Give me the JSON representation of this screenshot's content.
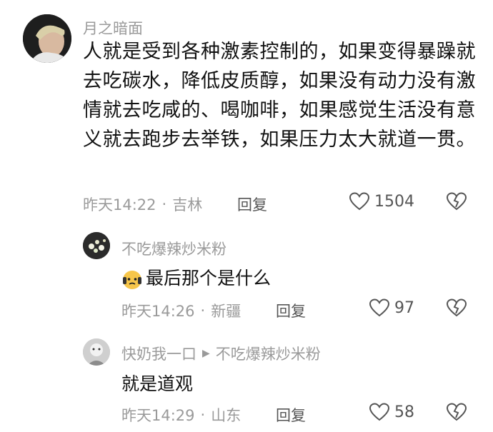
{
  "comment": {
    "username": "月之暗面",
    "text": "人就是受到各种激素控制的，如果变得暴躁就去吃碳水，降低皮质醇，如果没有动力没有激情就去吃咸的、喝咖啡，如果感觉生活没有意义就去跑步去举铁，如果压力太大就道一贯。",
    "time": "昨天14:22",
    "location": "吉林",
    "reply_label": "回复",
    "likes": "1504"
  },
  "replies": [
    {
      "username": "不吃爆辣炒米粉",
      "text": "最后那个是什么",
      "time": "昨天14:26",
      "location": "新疆",
      "reply_label": "回复",
      "likes": "97"
    },
    {
      "username": "快奶我一口",
      "reply_to": "不吃爆辣炒米粉",
      "text": "就是道观",
      "time": "昨天14:29",
      "location": "山东",
      "reply_label": "回复",
      "likes": "58"
    }
  ],
  "separator": "·"
}
